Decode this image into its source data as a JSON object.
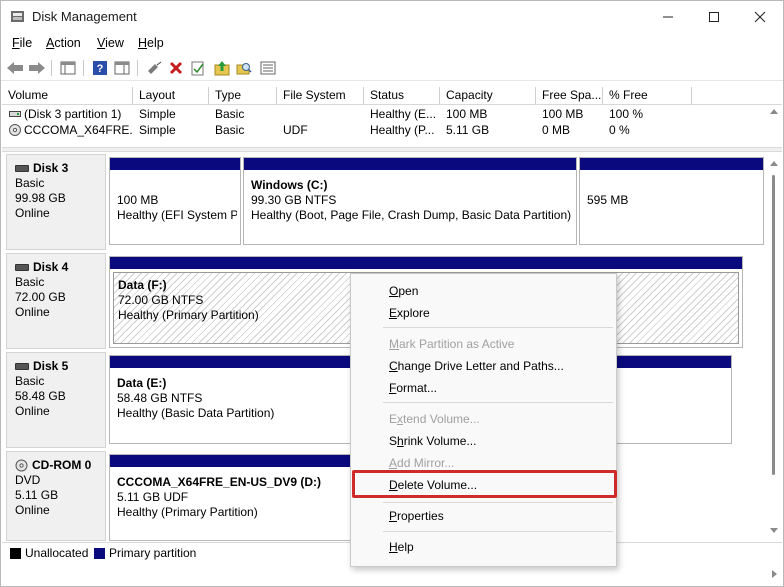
{
  "window": {
    "title": "Disk Management"
  },
  "menubar": {
    "items": [
      {
        "label": "File",
        "mnemonic": "F",
        "rest": "ile"
      },
      {
        "label": "Action",
        "mnemonic": "A",
        "rest": "ction"
      },
      {
        "label": "View",
        "mnemonic": "V",
        "rest": "iew"
      },
      {
        "label": "Help",
        "mnemonic": "H",
        "rest": "elp"
      }
    ]
  },
  "volume_table": {
    "columns": [
      "Volume",
      "Layout",
      "Type",
      "File System",
      "Status",
      "Capacity",
      "Free Spa...",
      "% Free"
    ],
    "rows": [
      {
        "volume": "(Disk 3 partition 1)",
        "layout": "Simple",
        "type": "Basic",
        "fs": "",
        "status": "Healthy (E...",
        "capacity": "100 MB",
        "free": "100 MB",
        "pct": "100 %"
      },
      {
        "volume": "CCCOMA_X64FRE...",
        "layout": "Simple",
        "type": "Basic",
        "fs": "UDF",
        "status": "Healthy (P...",
        "capacity": "5.11 GB",
        "free": "0 MB",
        "pct": "0 %"
      }
    ]
  },
  "disks": [
    {
      "name": "Disk 3",
      "type": "Basic",
      "size": "99.98 GB",
      "state": "Online",
      "partitions": [
        {
          "title": "",
          "line1": "100 MB",
          "line2": "Healthy (EFI System Pa"
        },
        {
          "title": "Windows  (C:)",
          "line1": "99.30 GB NTFS",
          "line2": "Healthy (Boot, Page File, Crash Dump, Basic Data Partition)"
        },
        {
          "title": "",
          "line1": "595 MB",
          "line2": ""
        }
      ]
    },
    {
      "name": "Disk 4",
      "type": "Basic",
      "size": "72.00 GB",
      "state": "Online",
      "partitions": [
        {
          "title": "Data  (F:)",
          "line1": "72.00 GB NTFS",
          "line2": "Healthy (Primary Partition)"
        }
      ]
    },
    {
      "name": "Disk 5",
      "type": "Basic",
      "size": "58.48 GB",
      "state": "Online",
      "partitions": [
        {
          "title": "Data  (E:)",
          "line1": "58.48 GB NTFS",
          "line2": "Healthy (Basic Data Partition)"
        }
      ]
    },
    {
      "name": "CD-ROM 0",
      "type": "DVD",
      "size": "5.11 GB",
      "state": "Online",
      "partitions": [
        {
          "title": "CCCOMA_X64FRE_EN-US_DV9  (D:)",
          "line1": "5.11 GB UDF",
          "line2": "Healthy (Primary Partition)"
        }
      ]
    }
  ],
  "legend": {
    "items": [
      {
        "label": "Unallocated",
        "color": "#000000"
      },
      {
        "label": "Primary partition",
        "color": "#0a0a7e"
      }
    ]
  },
  "context_menu": {
    "items": [
      {
        "label": "Open",
        "mnemonic": "O",
        "rest": "pen",
        "enabled": true
      },
      {
        "label": "Explore",
        "mnemonic": "E",
        "rest": "xplore",
        "enabled": true
      },
      {
        "label": "Mark Partition as Active",
        "mnemonic": "M",
        "rest": "ark Partition as Active",
        "enabled": false
      },
      {
        "label": "Change Drive Letter and Paths...",
        "mnemonic": "C",
        "rest": "hange Drive Letter and Paths...",
        "enabled": true
      },
      {
        "label": "Format...",
        "mnemonic": "F",
        "rest": "ormat...",
        "enabled": true
      },
      {
        "label": "Extend Volume...",
        "mnemonic": "x",
        "rest": "tend Volume...",
        "pre": "E",
        "enabled": false
      },
      {
        "label": "Shrink Volume...",
        "mnemonic": "h",
        "rest": "rink Volume...",
        "pre": "S",
        "enabled": true
      },
      {
        "label": "Add Mirror...",
        "mnemonic": "A",
        "rest": "dd Mirror...",
        "enabled": false
      },
      {
        "label": "Delete Volume...",
        "mnemonic": "D",
        "rest": "elete Volume...",
        "enabled": true
      },
      {
        "label": "Properties",
        "mnemonic": "P",
        "rest": "roperties",
        "enabled": true
      },
      {
        "label": "Help",
        "mnemonic": "H",
        "rest": "elp",
        "enabled": true
      }
    ],
    "highlight_color": "#d02b2b"
  }
}
